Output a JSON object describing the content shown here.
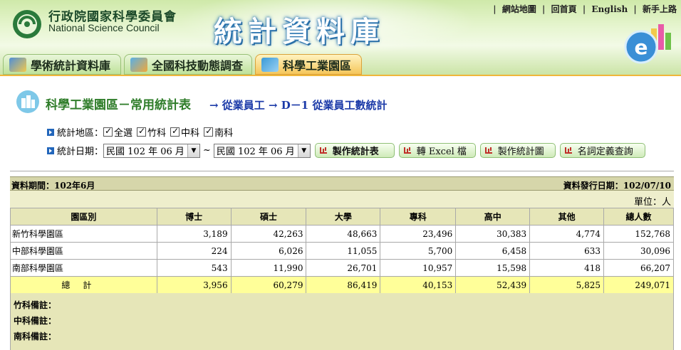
{
  "header": {
    "org_name_zh": "行政院國家科學委員會",
    "org_name_en": "National Science Council",
    "db_title": "統計資料庫",
    "top_links": [
      "網站地圖",
      "回首頁",
      "English",
      "新手上路"
    ],
    "e_logo_letter": "e"
  },
  "tabs": [
    {
      "label": "學術統計資料庫",
      "active": false
    },
    {
      "label": "全國科技動態調查",
      "active": false
    },
    {
      "label": "科學工業園區",
      "active": true
    }
  ],
  "page": {
    "title": "科學工業園區－常用統計表",
    "path": "→ 從業員工 → D－1  從業員工數統計"
  },
  "filters": {
    "region_label": "統計地區：",
    "regions": [
      {
        "label": "全選",
        "checked": true
      },
      {
        "label": "竹科",
        "checked": true
      },
      {
        "label": "中科",
        "checked": true
      },
      {
        "label": "南科",
        "checked": true
      }
    ],
    "date_label": "統計日期：",
    "date_from": "民國 102 年 06 月",
    "date_sep": "~",
    "date_to": "民國 102 年 06 月",
    "buttons": [
      "製作統計表",
      "轉 Excel 檔",
      "製作統計圖",
      "名詞定義查詢"
    ]
  },
  "report": {
    "period": "資料期間：102年6月",
    "issue_date": "資料發行日期：102/07/10",
    "unit": "單位：人",
    "columns": [
      "園區別",
      "博士",
      "碩士",
      "大學",
      "專科",
      "高中",
      "其他",
      "總人數"
    ],
    "rows": [
      [
        "新竹科學園區",
        "3,189",
        "42,263",
        "48,663",
        "23,496",
        "30,383",
        "4,774",
        "152,768"
      ],
      [
        "中部科學園區",
        "224",
        "6,026",
        "11,055",
        "5,700",
        "6,458",
        "633",
        "30,096"
      ],
      [
        "南部科學園區",
        "543",
        "11,990",
        "26,701",
        "10,957",
        "15,598",
        "418",
        "66,207"
      ]
    ],
    "total": [
      "總計",
      "3,956",
      "60,279",
      "86,419",
      "40,153",
      "52,439",
      "5,825",
      "249,071"
    ],
    "notes": [
      "竹科備註：",
      "中科備註：",
      "南科備註："
    ]
  },
  "colors": {
    "header_green": "#cfe9a9",
    "active_tab": "#f5c65a",
    "title_green": "#2f7d2a",
    "path_blue": "#1b3aa8",
    "table_header": "#e6e6b8",
    "total_row": "#ffff99"
  },
  "icons": [
    "logo-mark-icon",
    "e-logo-icon",
    "tab-book-icon",
    "tab-survey-icon",
    "tab-park-icon",
    "page-title-icon",
    "bullet-arrow-icon",
    "checkbox-icon",
    "dropdown-arrow-icon",
    "chart-button-icon"
  ]
}
